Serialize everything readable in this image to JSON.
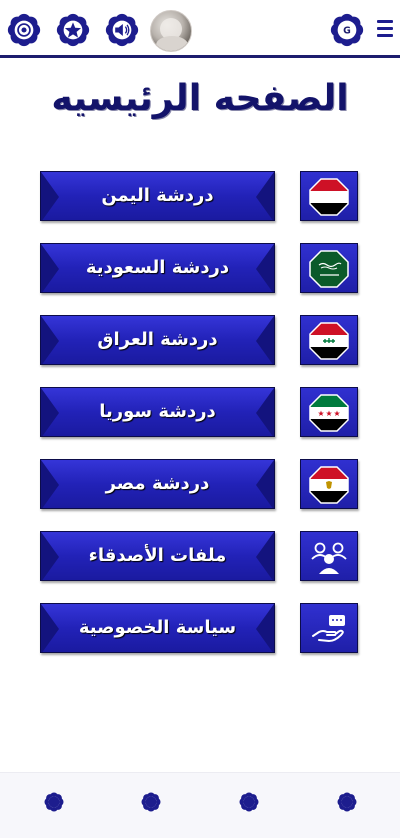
{
  "title": "الصفحه الرئيسيه",
  "colors": {
    "primary": "#1d1d6e",
    "button": "#2828c8",
    "bevel": "#13137e",
    "title": "#13136a"
  },
  "topbar": {
    "left_icons": [
      "settings-flower-icon",
      "star-icon",
      "speaker-icon"
    ],
    "right_icons": [
      "google-icon",
      "menu-icon"
    ],
    "google_letter": "G"
  },
  "menu": [
    {
      "label": "دردشة اليمن",
      "icon": "yemen-flag-icon"
    },
    {
      "label": "دردشة السعودية",
      "icon": "saudi-flag-icon"
    },
    {
      "label": "دردشة العراق",
      "icon": "iraq-flag-icon"
    },
    {
      "label": "دردشة سوريا",
      "icon": "syria-flag-icon"
    },
    {
      "label": "دردشة مصر",
      "icon": "egypt-flag-icon"
    },
    {
      "label": "ملفات الأصدقاء",
      "icon": "friends-icon"
    },
    {
      "label": "سياسة الخصوصية",
      "icon": "privacy-hand-icon"
    }
  ],
  "bottom_nav": [
    "nav-icon-1",
    "nav-icon-2",
    "nav-icon-3",
    "nav-icon-4"
  ]
}
